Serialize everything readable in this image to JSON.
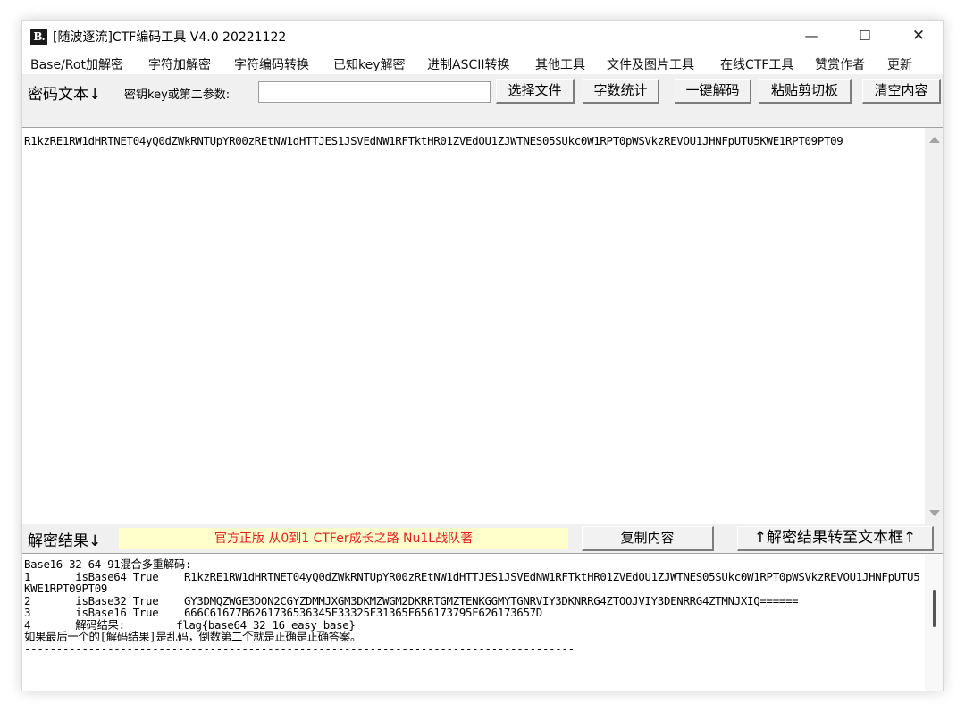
{
  "window": {
    "icon_text": "B.",
    "title": "[随波逐流]CTF编码工具 V4.0 20221122",
    "controls": {
      "minimize": "—",
      "maximize": "☐",
      "close": "✕"
    }
  },
  "menu": [
    "Base/Rot加解密",
    "字符加解密",
    "字符编码转换",
    "已知key解密",
    "进制ASCII转换",
    "其他工具",
    "文件及图片工具",
    "在线CTF工具",
    "赞赏作者",
    "更新"
  ],
  "toolbar": {
    "cipher_label": "密码文本↓",
    "key_label": "密钥key或第二参数:",
    "key_value": "",
    "buttons": [
      "选择文件",
      "字数统计",
      "一键解码",
      "粘贴剪切板",
      "清空内容"
    ]
  },
  "input_text": "R1kzRE1RW1dHRTNET04yQ0dZWkRNTUpYR00zREtNW1dHTTJES1JSVEdNW1RFTktHR01ZVEdOU1ZJWTNES05SUkc0W1RPT0pWSVkzREVOU1JHNFpUTU5KWE1RPT09PT09",
  "result_bar": {
    "label": "解密结果↓",
    "notice": "官方正版 从0到1 CTFer成长之路 Nu1L战队著",
    "copy_button": "复制内容",
    "transfer_button": "↑解密结果转至文本框↑"
  },
  "result_text": "Base16-32-64-91混合多重解码:\n1       isBase64 True    R1kzRE1RW1dHRTNET04yQ0dZWkRNTUpYR00zREtNW1dHTTJES1JSVEdNW1RFTktHR01ZVEdOU1ZJWTNES05SUkc0W1RPT0pWSVkzREVOU1JHNFpUTU5KWE1RPT09PT09\n2       isBase32 True    GY3DMQZWGE3DON2CGYZDMMJXGM3DKMZWGM2DKRRTGMZTENKGGMYTGNRVIY3DKNRRG4ZTOOJVIY3DENRRG4ZTMNJXIQ======\n3       isBase16 True    666C61677B6261736536345F33325F31365F656173795F626173657D\n4       解码结果:        flag{base64_32_16_easy_base}\n如果最后一个的[解码结果]是乱码，倒数第二个就是正确是正确答案。\n--------------------------------------------------------------------------------------"
}
